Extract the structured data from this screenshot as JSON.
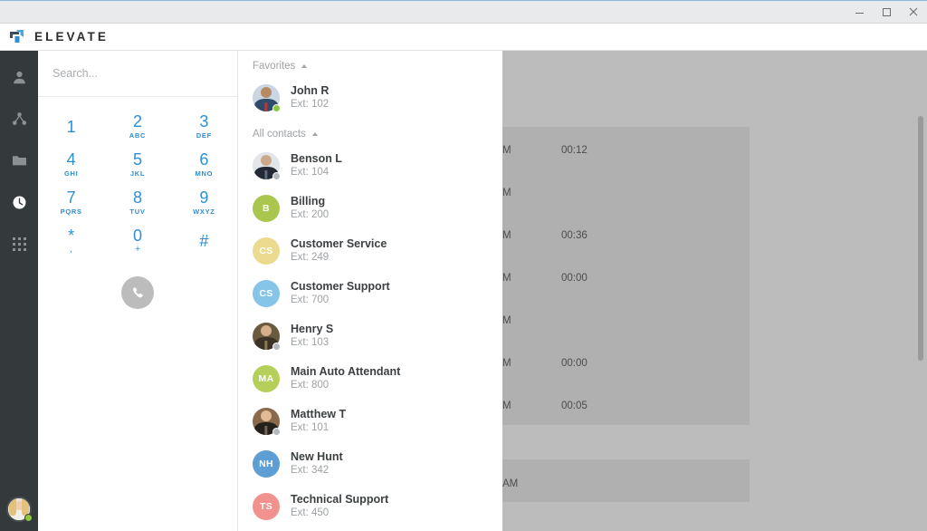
{
  "window": {
    "controls": [
      {
        "name": "minimize",
        "label": "—"
      },
      {
        "name": "maximize",
        "label": "□"
      },
      {
        "name": "close",
        "label": "✕"
      }
    ]
  },
  "brand": {
    "name": "ELEVATE",
    "logo_icon": "elevate-arrow-logo",
    "accent_color": "#2d8fd5"
  },
  "sidebar": {
    "items": [
      {
        "icon": "person-icon",
        "name": "contacts",
        "active": false
      },
      {
        "icon": "share-nodes-icon",
        "name": "team",
        "active": false
      },
      {
        "icon": "folder-icon",
        "name": "files",
        "active": false
      },
      {
        "icon": "clock-icon",
        "name": "call-history",
        "active": true
      },
      {
        "icon": "grid-apps-icon",
        "name": "apps",
        "active": false
      }
    ],
    "user_avatar": {
      "name": "user-avatar",
      "status": "available",
      "status_color": "#8ec63f"
    }
  },
  "dialer": {
    "search": {
      "placeholder": "Search...",
      "value": ""
    },
    "keys": [
      {
        "digit": "1",
        "sub": ""
      },
      {
        "digit": "2",
        "sub": "ABC"
      },
      {
        "digit": "3",
        "sub": "DEF"
      },
      {
        "digit": "4",
        "sub": "GHI"
      },
      {
        "digit": "5",
        "sub": "JKL"
      },
      {
        "digit": "6",
        "sub": "MNO"
      },
      {
        "digit": "7",
        "sub": "PQRS"
      },
      {
        "digit": "8",
        "sub": "TUV"
      },
      {
        "digit": "9",
        "sub": "WXYZ"
      },
      {
        "digit": "*",
        "sub": ","
      },
      {
        "digit": "0",
        "sub": "+"
      },
      {
        "digit": "#",
        "sub": ""
      }
    ],
    "call_button": {
      "icon": "phone-icon",
      "color": "#bcbcbc"
    }
  },
  "contacts": {
    "groups": [
      {
        "label": "Favorites",
        "items": [
          {
            "name": "John R",
            "ext": "Ext: 102",
            "avatar_type": "photo",
            "photo": {
              "bg": "#c9d7e2",
              "head": "#b98a62",
              "body": "#2f4a6b",
              "tie": "#b33a3a"
            },
            "status": "available",
            "status_color": "#8ec63f"
          }
        ]
      },
      {
        "label": "All contacts",
        "items": [
          {
            "name": "Benson L",
            "ext": "Ext: 104",
            "avatar_type": "photo",
            "photo": {
              "bg": "#e2e6ea",
              "head": "#cda98c",
              "body": "#232a35",
              "tie": "#5b6a7d"
            },
            "status": "offline",
            "status_color": "#b5b9bc"
          },
          {
            "name": "Billing",
            "ext": "Ext: 200",
            "avatar_type": "initials",
            "initials": "B",
            "avatar_color": "#a8c council",
            "color": "#a9c74f",
            "status": "none",
            "status_color": ""
          },
          {
            "name": "Customer Service",
            "ext": "Ext: 249",
            "avatar_type": "initials",
            "initials": "CS",
            "color": "#ecdb8e",
            "status": "none",
            "status_color": ""
          },
          {
            "name": "Customer Support",
            "ext": "Ext: 700",
            "avatar_type": "initials",
            "initials": "CS",
            "color": "#86c5e8",
            "status": "none",
            "status_color": ""
          },
          {
            "name": "Henry S",
            "ext": "Ext: 103",
            "avatar_type": "photo",
            "photo": {
              "bg": "#6b5b3e",
              "head": "#d6b08a",
              "body": "#3a3326",
              "tie": "#8a7a55"
            },
            "status": "offline",
            "status_color": "#b5b9bc"
          },
          {
            "name": "Main Auto Attendant",
            "ext": "Ext: 800",
            "avatar_type": "initials",
            "initials": "MA",
            "color": "#b5d05a",
            "status": "none",
            "status_color": ""
          },
          {
            "name": "Matthew T",
            "ext": "Ext: 101",
            "avatar_type": "photo",
            "photo": {
              "bg": "#8a6a4a",
              "head": "#e0bb93",
              "body": "#24201c",
              "tie": "#6f655a"
            },
            "status": "offline",
            "status_color": "#b5b9bc"
          },
          {
            "name": "New Hunt",
            "ext": "Ext: 342",
            "avatar_type": "initials",
            "initials": "NH",
            "color": "#5d9fd4",
            "status": "none",
            "status_color": ""
          },
          {
            "name": "Technical Support",
            "ext": "Ext: 450",
            "avatar_type": "initials",
            "initials": "TS",
            "color": "#f2928f",
            "status": "none",
            "status_color": ""
          }
        ]
      }
    ]
  },
  "background_call_history": {
    "dimmed": true,
    "rows": [
      {
        "time": "M",
        "duration": "00:12"
      },
      {
        "time": "M",
        "duration": ""
      },
      {
        "time": "M",
        "duration": "00:36"
      },
      {
        "time": "M",
        "duration": "00:00"
      },
      {
        "time": "M",
        "duration": ""
      },
      {
        "time": "M",
        "duration": "00:00"
      },
      {
        "time": "M",
        "duration": "00:05"
      },
      {
        "time": "AM",
        "duration": ""
      }
    ]
  }
}
